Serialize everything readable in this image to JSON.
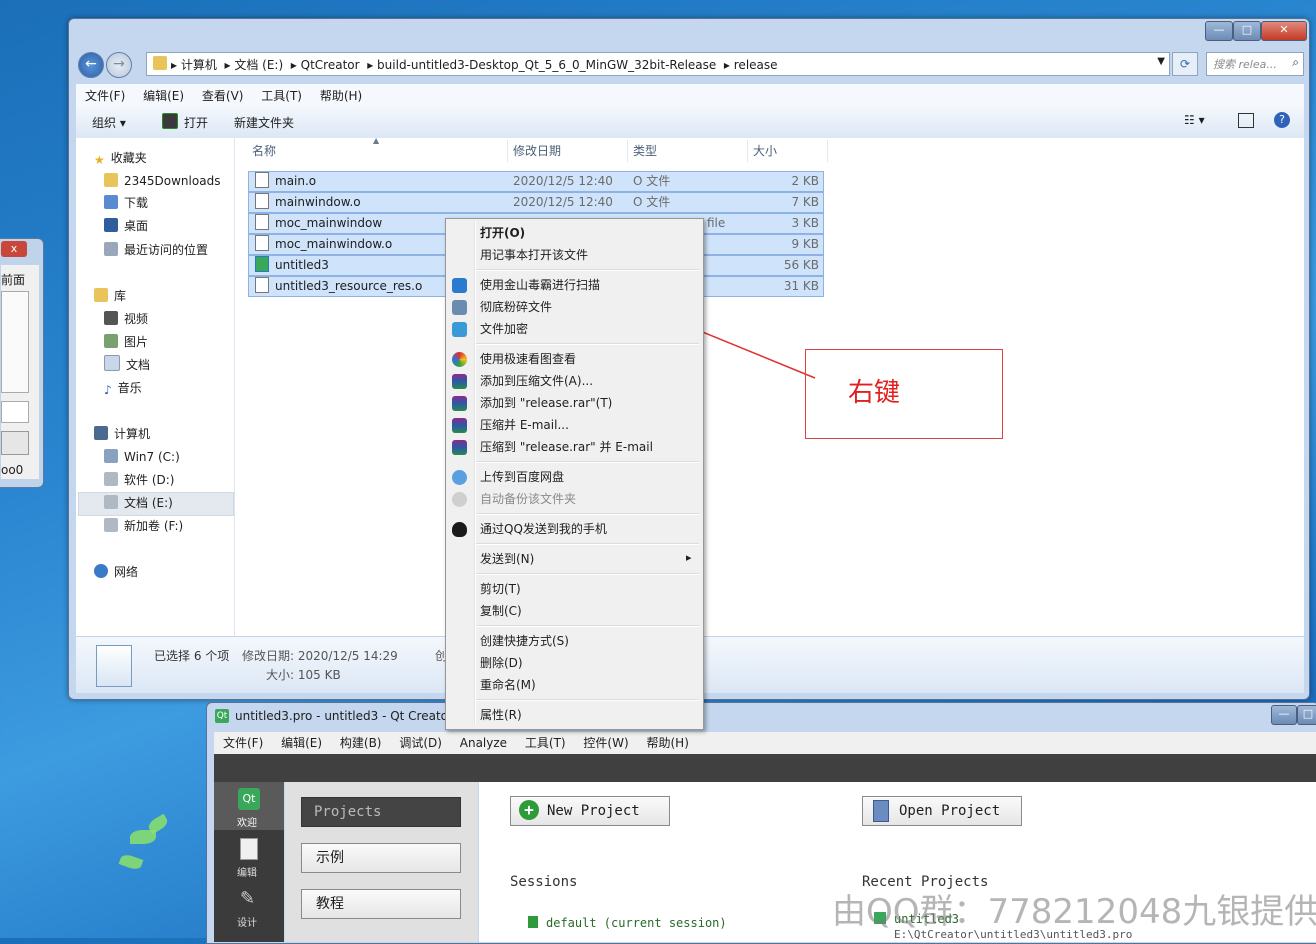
{
  "left_window": {
    "close_label": "x",
    "text1": "前面",
    "text2": "oo0"
  },
  "explorer": {
    "breadcrumb": [
      "计算机",
      "文档 (E:)",
      "QtCreator",
      "build-untitled3-Desktop_Qt_5_6_0_MinGW_32bit-Release",
      "release"
    ],
    "search_placeholder": "搜索 relea...",
    "menu": [
      "文件(F)",
      "编辑(E)",
      "查看(V)",
      "工具(T)",
      "帮助(H)"
    ],
    "toolbar": {
      "organize": "组织 ▾",
      "open": "打开",
      "new_folder": "新建文件夹"
    },
    "nav": {
      "favorites": "收藏夹",
      "fav_items": [
        "2345Downloads",
        "下载",
        "桌面",
        "最近访问的位置"
      ],
      "library": "库",
      "lib_items": [
        "视频",
        "图片",
        "文档",
        "音乐"
      ],
      "computer": "计算机",
      "drives": [
        "Win7 (C:)",
        "软件 (D:)",
        "文档 (E:)",
        "新加卷 (F:)"
      ],
      "network": "网络"
    },
    "columns": {
      "name": "名称",
      "modified": "修改日期",
      "type": "类型",
      "size": "大小"
    },
    "files": [
      {
        "name": "main.o",
        "modified": "2020/12/5 12:40",
        "type": "O 文件",
        "size": "2 KB"
      },
      {
        "name": "mainwindow.o",
        "modified": "2020/12/5 12:40",
        "type": "O 文件",
        "size": "7 KB"
      },
      {
        "name": "moc_mainwindow",
        "modified": "",
        "type": "file",
        "size": "3 KB"
      },
      {
        "name": "moc_mainwindow.o",
        "modified": "",
        "type": "",
        "size": "9 KB"
      },
      {
        "name": "untitled3",
        "modified": "",
        "type": "",
        "size": "56 KB"
      },
      {
        "name": "untitled3_resource_res.o",
        "modified": "",
        "type": "",
        "size": "31 KB"
      }
    ],
    "status": {
      "selected": "已选择 6 个项",
      "modified": "修改日期: 2020/12/5 14:29",
      "size": "大小: 105 KB",
      "created_partial": "创"
    }
  },
  "context_menu": {
    "items": [
      "打开(O)",
      "用记事本打开该文件",
      "使用金山毒霸进行扫描",
      "彻底粉碎文件",
      "文件加密",
      "使用极速看图查看",
      "添加到压缩文件(A)...",
      "添加到 \"release.rar\"(T)",
      "压缩并 E-mail...",
      "压缩到 \"release.rar\" 并 E-mail",
      "上传到百度网盘",
      "自动备份该文件夹",
      "通过QQ发送到我的手机",
      "发送到(N)",
      "剪切(T)",
      "复制(C)",
      "创建快捷方式(S)",
      "删除(D)",
      "重命名(M)",
      "属性(R)"
    ],
    "submenu_arrow": "▸"
  },
  "annotation": {
    "text": "右键"
  },
  "qt": {
    "title": "untitled3.pro - untitled3 - Qt Creator",
    "menu": [
      "文件(F)",
      "编辑(E)",
      "构建(B)",
      "调试(D)",
      "Analyze",
      "工具(T)",
      "控件(W)",
      "帮助(H)"
    ],
    "sidebar": [
      "欢迎",
      "编辑",
      "设计"
    ],
    "panel": [
      "Projects",
      "示例",
      "教程"
    ],
    "new_project": "New Project",
    "open_project": "Open Project",
    "sessions": "Sessions",
    "session_item": "default (current session)",
    "recent": "Recent Projects",
    "recent_item": "untitled3",
    "recent_path": "E:\\QtCreator\\untitled3\\untitled3.pro"
  },
  "watermark": "由QQ群：778212048九银提供"
}
